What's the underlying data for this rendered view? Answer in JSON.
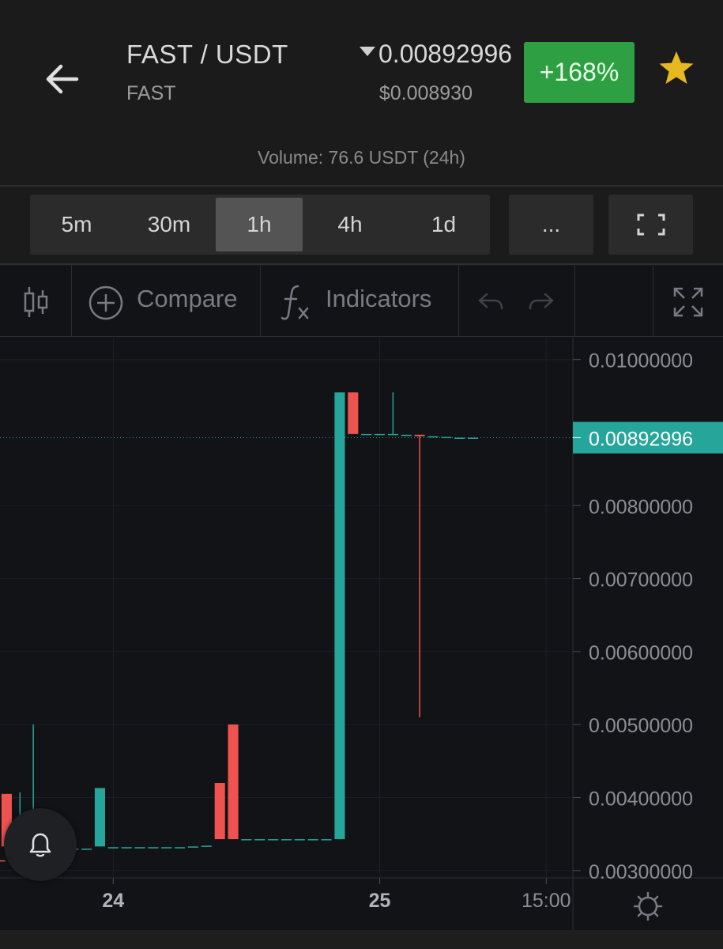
{
  "header": {
    "pair": "FAST / USDT",
    "base": "FAST",
    "price": "0.00892996",
    "usd_price": "$0.008930",
    "change": "+168%",
    "volume": "Volume: 76.6 USDT (24h)"
  },
  "intervals": [
    {
      "label": "5m",
      "active": false
    },
    {
      "label": "30m",
      "active": false
    },
    {
      "label": "1h",
      "active": true
    },
    {
      "label": "4h",
      "active": false
    },
    {
      "label": "1d",
      "active": false
    }
  ],
  "more_label": "...",
  "toolbar": {
    "compare_label": "Compare",
    "indicators_label": "Indicators"
  },
  "colors": {
    "up": "#26a69a",
    "down": "#ef5350",
    "positive_badge": "#2ea043",
    "star": "#e8b820",
    "background": "#121317"
  },
  "icons": [
    "back-arrow-icon",
    "star-icon",
    "fullscreen-icon",
    "candles-icon",
    "plus-circle-icon",
    "fx-icon",
    "undo-icon",
    "redo-icon",
    "expand-icon",
    "bell-icon",
    "settings-icon"
  ],
  "chart_data": {
    "type": "candlestick",
    "interval": "1h",
    "ylim": [
      0.0029,
      0.0103
    ],
    "y_ticks": [
      "0.01000000",
      "0.00800000",
      "0.00700000",
      "0.00600000",
      "0.00500000",
      "0.00400000",
      "0.00300000"
    ],
    "x_ticks": [
      {
        "label": "24",
        "index": 17
      },
      {
        "label": "25",
        "index": 57
      },
      {
        "label": "15:00",
        "index": 82
      }
    ],
    "x_range": [
      0,
      86
    ],
    "last_price": 0.00892996,
    "last_price_label": "0.00892996",
    "candles": [
      {
        "i": 0,
        "o": 0.00314,
        "h": 0.00314,
        "l": 0.00313,
        "c": 0.00313
      },
      {
        "i": 1,
        "o": 0.00405,
        "h": 0.00405,
        "l": 0.00333,
        "c": 0.00333
      },
      {
        "i": 3,
        "o": 0.00333,
        "h": 0.00407,
        "l": 0.00331,
        "c": 0.00333
      },
      {
        "i": 5,
        "o": 0.00332,
        "h": 0.005,
        "l": 0.0033,
        "c": 0.00333
      },
      {
        "i": 7,
        "o": 0.00331,
        "h": 0.00331,
        "l": 0.0033,
        "c": 0.0033
      },
      {
        "i": 9,
        "o": 0.0033,
        "h": 0.0033,
        "l": 0.0033,
        "c": 0.0033
      },
      {
        "i": 11,
        "o": 0.0033,
        "h": 0.0033,
        "l": 0.0033,
        "c": 0.0033
      },
      {
        "i": 13,
        "o": 0.0033,
        "h": 0.0033,
        "l": 0.0033,
        "c": 0.0033
      },
      {
        "i": 15,
        "o": 0.00333,
        "h": 0.00413,
        "l": 0.00333,
        "c": 0.00413
      },
      {
        "i": 17,
        "o": 0.00332,
        "h": 0.00332,
        "l": 0.00332,
        "c": 0.00332
      },
      {
        "i": 19,
        "o": 0.00332,
        "h": 0.00332,
        "l": 0.00332,
        "c": 0.00332
      },
      {
        "i": 21,
        "o": 0.00332,
        "h": 0.00332,
        "l": 0.00332,
        "c": 0.00332
      },
      {
        "i": 23,
        "o": 0.00332,
        "h": 0.00332,
        "l": 0.00332,
        "c": 0.00332
      },
      {
        "i": 25,
        "o": 0.00332,
        "h": 0.00332,
        "l": 0.00332,
        "c": 0.00332
      },
      {
        "i": 27,
        "o": 0.00332,
        "h": 0.00332,
        "l": 0.00332,
        "c": 0.00332
      },
      {
        "i": 29,
        "o": 0.00333,
        "h": 0.00333,
        "l": 0.00333,
        "c": 0.00333
      },
      {
        "i": 31,
        "o": 0.00334,
        "h": 0.00334,
        "l": 0.00334,
        "c": 0.00334
      },
      {
        "i": 33,
        "o": 0.0042,
        "h": 0.0042,
        "l": 0.00343,
        "c": 0.00343
      },
      {
        "i": 35,
        "o": 0.005,
        "h": 0.005,
        "l": 0.00343,
        "c": 0.00343
      },
      {
        "i": 37,
        "o": 0.00343,
        "h": 0.00343,
        "l": 0.00343,
        "c": 0.00343
      },
      {
        "i": 39,
        "o": 0.00343,
        "h": 0.00343,
        "l": 0.00343,
        "c": 0.00343
      },
      {
        "i": 41,
        "o": 0.00343,
        "h": 0.00343,
        "l": 0.00343,
        "c": 0.00343
      },
      {
        "i": 43,
        "o": 0.00343,
        "h": 0.00343,
        "l": 0.00343,
        "c": 0.00343
      },
      {
        "i": 45,
        "o": 0.00343,
        "h": 0.00343,
        "l": 0.00343,
        "c": 0.00343
      },
      {
        "i": 47,
        "o": 0.00343,
        "h": 0.00343,
        "l": 0.00343,
        "c": 0.00343
      },
      {
        "i": 49,
        "o": 0.00343,
        "h": 0.00343,
        "l": 0.00343,
        "c": 0.00343
      },
      {
        "i": 51,
        "o": 0.00343,
        "h": 0.00955,
        "l": 0.00343,
        "c": 0.00955
      },
      {
        "i": 53,
        "o": 0.00955,
        "h": 0.00955,
        "l": 0.00898,
        "c": 0.00898
      },
      {
        "i": 55,
        "o": 0.00898,
        "h": 0.00898,
        "l": 0.00898,
        "c": 0.00898
      },
      {
        "i": 57,
        "o": 0.00898,
        "h": 0.00898,
        "l": 0.00898,
        "c": 0.00898
      },
      {
        "i": 59,
        "o": 0.00898,
        "h": 0.00955,
        "l": 0.00898,
        "c": 0.00898
      },
      {
        "i": 61,
        "o": 0.00897,
        "h": 0.00897,
        "l": 0.00897,
        "c": 0.00897
      },
      {
        "i": 63,
        "o": 0.00897,
        "h": 0.00897,
        "l": 0.0051,
        "c": 0.00895
      },
      {
        "i": 65,
        "o": 0.00895,
        "h": 0.00895,
        "l": 0.00895,
        "c": 0.00895
      },
      {
        "i": 67,
        "o": 0.00894,
        "h": 0.00894,
        "l": 0.00894,
        "c": 0.00894
      },
      {
        "i": 69,
        "o": 0.00893,
        "h": 0.00893,
        "l": 0.00893,
        "c": 0.00893
      },
      {
        "i": 71,
        "o": 0.00893,
        "h": 0.00893,
        "l": 0.00893,
        "c": 0.00893
      }
    ]
  }
}
